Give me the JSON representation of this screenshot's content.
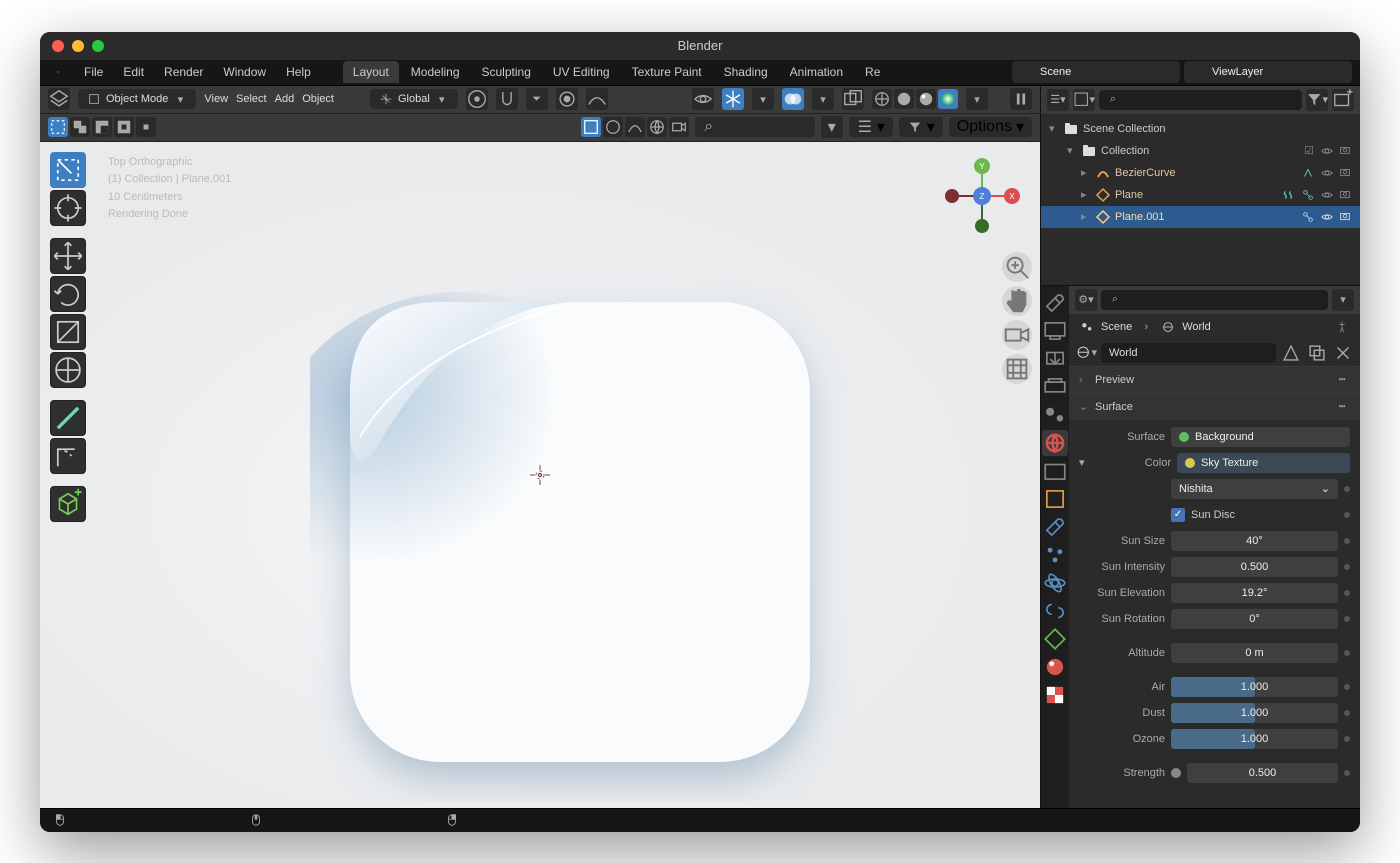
{
  "title": "Blender",
  "menu": {
    "items": [
      "File",
      "Edit",
      "Render",
      "Window",
      "Help"
    ]
  },
  "workspaces": {
    "tabs": [
      "Layout",
      "Modeling",
      "Sculpting",
      "UV Editing",
      "Texture Paint",
      "Shading",
      "Animation",
      "Re"
    ],
    "active": 0
  },
  "header": {
    "scene_label": "Scene",
    "scene_value": "Scene",
    "viewlayer_value": "ViewLayer"
  },
  "toolbar": {
    "mode": "Object Mode",
    "view": "View",
    "select": "Select",
    "add": "Add",
    "object": "Object",
    "orientation": "Global"
  },
  "viewport_header": {
    "options": "Options"
  },
  "overlay": {
    "projection": "Top Orthographic",
    "collection": "(1) Collection | Plane.001",
    "scale": "10 Centimeters",
    "status": "Rendering Done"
  },
  "outliner": {
    "root": "Scene Collection",
    "coll": "Collection",
    "items": [
      {
        "name": "BezierCurve",
        "type": "curve"
      },
      {
        "name": "Plane",
        "type": "mesh"
      },
      {
        "name": "Plane.001",
        "type": "mesh",
        "selected": true
      }
    ]
  },
  "props": {
    "breadcrumb": {
      "scene": "Scene",
      "world": "World"
    },
    "datablock": "World",
    "panels": {
      "preview": "Preview",
      "surface": "Surface"
    },
    "surface": {
      "surface_label": "Surface",
      "surface_value": "Background",
      "color_label": "Color",
      "color_value": "Sky Texture",
      "sky_type": "Nishita",
      "sun_disc_label": "Sun Disc",
      "rows": [
        {
          "label": "Sun Size",
          "value": "40°"
        },
        {
          "label": "Sun Intensity",
          "value": "0.500"
        },
        {
          "label": "Sun Elevation",
          "value": "19.2°"
        },
        {
          "label": "Sun Rotation",
          "value": "0°"
        },
        {
          "label": "Altitude",
          "value": "0 m"
        },
        {
          "label": "Air",
          "value": "1.000",
          "fill": 0.5
        },
        {
          "label": "Dust",
          "value": "1.000",
          "fill": 0.5
        },
        {
          "label": "Ozone",
          "value": "1.000",
          "fill": 0.5
        }
      ],
      "strength_label": "Strength",
      "strength_value": "0.500"
    }
  }
}
